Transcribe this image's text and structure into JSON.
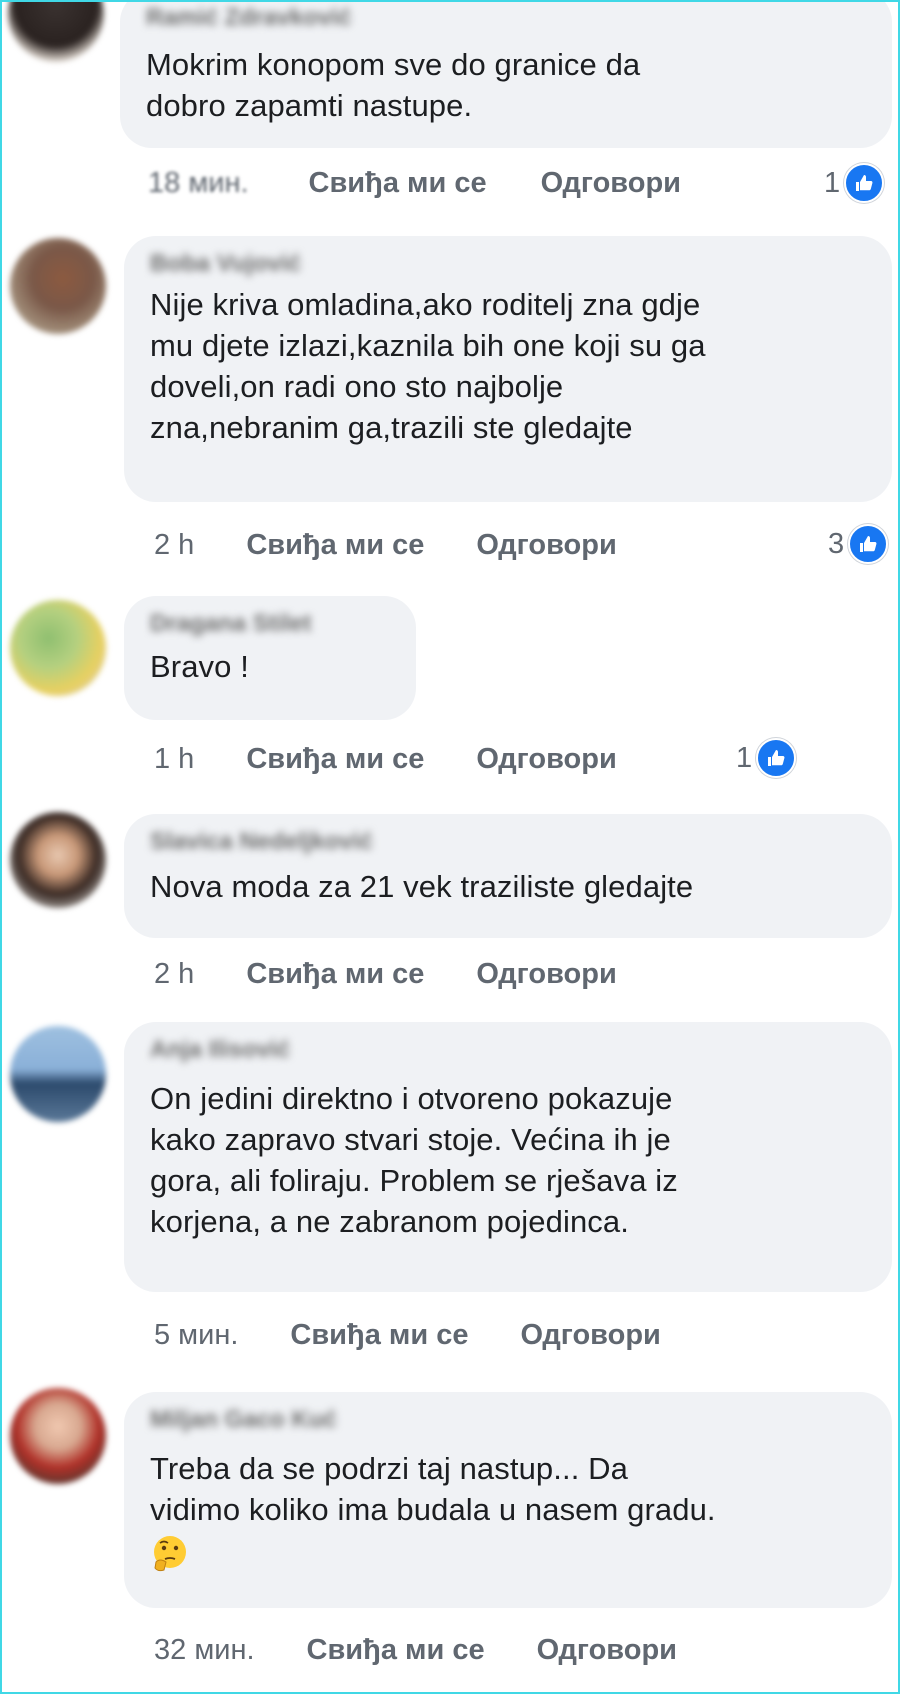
{
  "comments": [
    {
      "author": "Ramić Zdravković",
      "text": "Mokrim konopom sve do granice da\ndobro zapamti nastupe.",
      "time": "18 мин.",
      "like_label": "Свиђа ми се",
      "reply_label": "Одговори",
      "like_count": "1"
    },
    {
      "author": "Boba Vujović",
      "text": "Nije kriva omladina,ako roditelj zna gdje\nmu djete izlazi,kaznila bih one koji su ga\ndoveli,on radi ono sto najbolje\nzna,nebranim ga,trazili ste gledajte",
      "time": "2 h",
      "like_label": "Свиђа ми се",
      "reply_label": "Одговори",
      "like_count": "3"
    },
    {
      "author": "Dragana Stilet",
      "text": "Bravo !",
      "time": "1 h",
      "like_label": "Свиђа ми се",
      "reply_label": "Одговори",
      "like_count": "1"
    },
    {
      "author": "Slavica Nedeljković",
      "text": "Nova moda  za  21 vek traziliste gledajte",
      "time": "2 h",
      "like_label": "Свиђа ми се",
      "reply_label": "Одговори",
      "like_count": ""
    },
    {
      "author": "Anja Ilisović",
      "text": "On jedini direktno i otvoreno pokazuje\nkako zapravo stvari stoje. Većina ih je\ngora, ali foliraju. Problem se rješava iz\nkorjena, a ne zabranom pojedinca.",
      "time": "5 мин.",
      "like_label": "Свиђа ми се",
      "reply_label": "Одговори",
      "like_count": ""
    },
    {
      "author": "Miljan Gaco Kuć",
      "text": "Treba da se podrzi taj nastup... Da\nvidimo koliko ima budala u nasem gradu.",
      "emoji": "thinking-face-emoji",
      "time": "32 мин.",
      "like_label": "Свиђа ми се",
      "reply_label": "Одговори",
      "like_count": ""
    }
  ],
  "colors": {
    "bubble": "#f0f2f5",
    "text": "#1c1e21",
    "meta": "#606770",
    "like_badge": "#1877f2",
    "border": "#40d8e6"
  },
  "icons": {
    "like": "thumbs-up-icon",
    "avatar": "avatar-image"
  }
}
